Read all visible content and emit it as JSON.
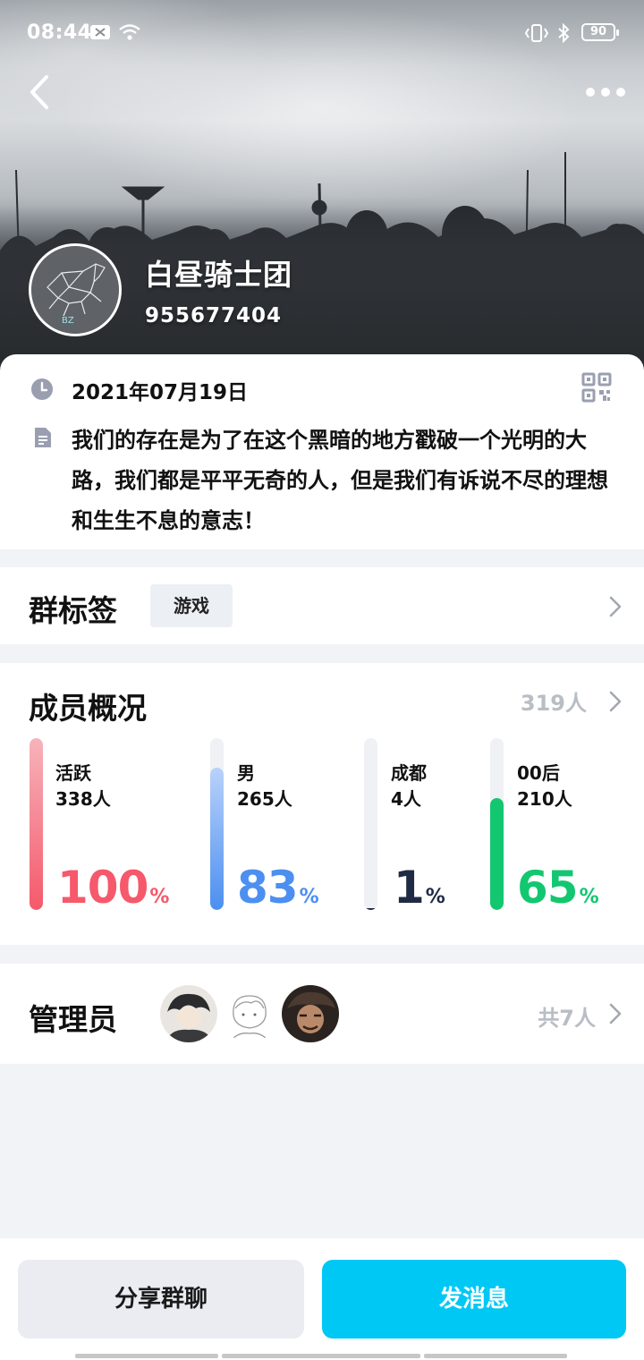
{
  "status_bar": {
    "time": "08:44",
    "battery": "90"
  },
  "group": {
    "name": "白昼骑士团",
    "id": "955677404",
    "avatar_text": "BZ",
    "created_date": "2021年07月19日",
    "description": "我们的存在是为了在这个黑暗的地方戳破一个光明的大路，我们都是平平无奇的人，但是我们有诉说不尽的理想和生生不息的意志！"
  },
  "tags": {
    "title": "群标签",
    "items": [
      "游戏"
    ]
  },
  "members": {
    "title": "成员概况",
    "count": "319人",
    "stats": [
      {
        "label": "活跃",
        "count": "338人",
        "percent": 100,
        "unit": "%",
        "color": "#f5596b",
        "fill_top": "#f7b3bb"
      },
      {
        "label": "男",
        "count": "265人",
        "percent": 83,
        "unit": "%",
        "color": "#4c8ff0",
        "fill_top": "#b9d2fa"
      },
      {
        "label": "成都",
        "count": "4人",
        "percent": 1,
        "unit": "%",
        "color": "#1f2a44",
        "fill_top": "#1f2a44"
      },
      {
        "label": "00后",
        "count": "210人",
        "percent": 65,
        "unit": "%",
        "color": "#12c770",
        "fill_top": "#12c770"
      }
    ]
  },
  "admins": {
    "title": "管理员",
    "total": "共7人"
  },
  "actions": {
    "share_label": "分享群聊",
    "send_label": "发消息"
  },
  "icons": {
    "back": "back-chevron-icon",
    "more": "more-dots-icon",
    "date": "clock-icon",
    "description": "document-icon",
    "qr": "qr-code-icon",
    "chevron": "chevron-right-icon"
  },
  "colors": {
    "accent": "#00c8f5",
    "background": "#f2f3f7",
    "muted_text": "#b9bdc4"
  }
}
